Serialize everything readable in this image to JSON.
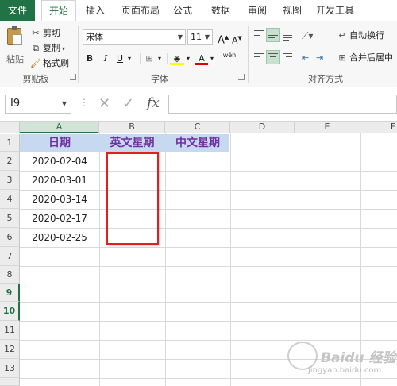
{
  "tabs": {
    "file": "文件",
    "home": "开始",
    "insert": "插入",
    "page_layout": "页面布局",
    "formulas": "公式",
    "data": "数据",
    "review": "审阅",
    "view": "视图",
    "developer": "开发工具"
  },
  "ribbon": {
    "clipboard": {
      "paste": "粘贴",
      "cut": "剪切",
      "copy": "复制",
      "format_painter": "格式刷",
      "group_label": "剪贴板"
    },
    "font": {
      "font_name": "宋体",
      "font_size": "11",
      "bold": "B",
      "italic": "I",
      "underline": "U",
      "grow": "A",
      "shrink": "A",
      "font_color": "A",
      "phonetic": "wén",
      "group_label": "字体"
    },
    "alignment": {
      "wrap_text": "自动换行",
      "merge_center": "合并后居中",
      "group_label": "对齐方式"
    }
  },
  "formula_bar": {
    "name_box": "I9",
    "cancel": "✕",
    "confirm": "✓",
    "fx": "fx",
    "formula": ""
  },
  "sheet": {
    "columns": [
      "A",
      "B",
      "C",
      "D",
      "E",
      "F"
    ],
    "rows": [
      "1",
      "2",
      "3",
      "4",
      "5",
      "6",
      "7",
      "8",
      "9",
      "10",
      "11",
      "12",
      "13"
    ],
    "headers": {
      "a1": "日期",
      "b1": "英文星期",
      "c1": "中文星期"
    },
    "dates": [
      "2020-02-04",
      "2020-03-01",
      "2020-03-14",
      "2020-02-17",
      "2020-02-25"
    ]
  },
  "watermark": {
    "brand": "Baidu 经验",
    "url": "jingyan.baidu.com"
  },
  "colors": {
    "excel_green": "#217346",
    "header_fill": "#c6d9f0",
    "header_text": "#7030a0",
    "highlight_box": "#e02020"
  }
}
